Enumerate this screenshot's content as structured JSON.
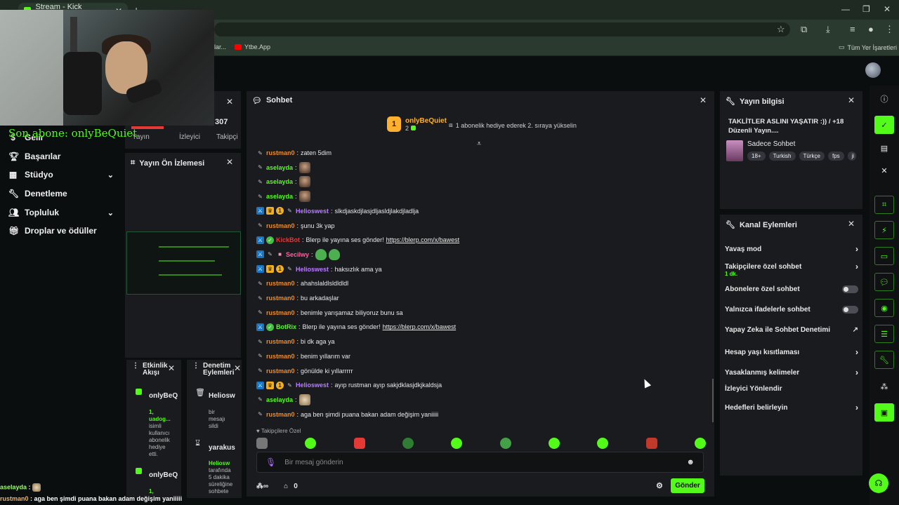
{
  "browser": {
    "tab_title": "Stream - Kick Dashboard",
    "bookmarks": [
      {
        "label": "lar..."
      },
      {
        "label": "Ytbe.App"
      },
      {
        "label": "Tüm Yer İşaretleri"
      }
    ]
  },
  "overlay": {
    "latest_sub": "Son abone: onlyBeQuiet",
    "chat": [
      {
        "user": "aselayda",
        "sep": " : ",
        "text": ""
      },
      {
        "user": "rustman0",
        "sep": " : ",
        "text": "aga ben şimdi puana bakan adam değişim yaniiiii"
      }
    ]
  },
  "sidebar": {
    "items": [
      {
        "label": "Gelir",
        "icon": "dollar-icon"
      },
      {
        "label": "Başarılar",
        "icon": "trophy-icon"
      },
      {
        "label": "Stüdyo",
        "icon": "grid-icon",
        "expandable": true
      },
      {
        "label": "Denetleme",
        "icon": "wrench-icon"
      },
      {
        "label": "Topluluk",
        "icon": "people-icon",
        "expandable": true
      },
      {
        "label": "Droplar ve ödüller",
        "icon": "gift-icon"
      }
    ]
  },
  "stats": {
    "value": "307",
    "labels": [
      "Yayın",
      "İzleyici",
      "Takipçi"
    ]
  },
  "preview": {
    "title": "Yayın Ön İzlemesi"
  },
  "activity_feed": {
    "title": "Etkinlik Akışı",
    "entries": [
      {
        "name": "onlyBeQ",
        "text_line1": "1,",
        "text_line2": "uadog...",
        "text_rest": [
          "isimli",
          "kullanıcı",
          "abonelik",
          "hediye",
          "etti."
        ]
      },
      {
        "name": "onlyBeQ",
        "text_line1": "1,",
        "text_line2": "",
        "text_rest": []
      }
    ]
  },
  "mod_actions": {
    "title": "Denetim Eylemleri",
    "entries": [
      {
        "name": "Heliosw",
        "text": [
          "bir",
          "mesajı",
          "sildi"
        ]
      },
      {
        "name": "yarakus",
        "text": [
          "Heliosw",
          "tarafında",
          "5 dakika",
          "süreliğine",
          "sohbete"
        ]
      }
    ]
  },
  "chat": {
    "title": "Sohbet",
    "pinned": {
      "rank": "1",
      "user": "onlyBeQuiet",
      "count": "2",
      "text": "1 abonelik hediye ederek 2. sıraya yükselin"
    },
    "messages": [
      {
        "user": "rustman0",
        "color": "#f08a24",
        "badges": [
          "pencil"
        ],
        "text": "zaten 5dim"
      },
      {
        "user": "aselayda",
        "color": "#53fc18",
        "badges": [
          "pencil"
        ],
        "text": "",
        "emotes": [
          "face"
        ]
      },
      {
        "user": "aselayda",
        "color": "#53fc18",
        "badges": [
          "pencil"
        ],
        "text": "",
        "emotes": [
          "face"
        ]
      },
      {
        "user": "aselayda",
        "color": "#53fc18",
        "badges": [
          "pencil"
        ],
        "text": "",
        "emotes": [
          "face"
        ]
      },
      {
        "user": "Helioswest",
        "color": "#b87dff",
        "badges": [
          "mod",
          "crown",
          "sub",
          "pencil"
        ],
        "text": "slkdjaskdjlasjdljasldjlakdjladlja"
      },
      {
        "user": "rustman0",
        "color": "#f08a24",
        "badges": [
          "pencil"
        ],
        "text": "şunu 3k yap"
      },
      {
        "user": "KickBot",
        "color": "#e53935",
        "badges": [
          "mod",
          "verified"
        ],
        "text": "Blerp ile yayına ses gönder! ",
        "link": "https://blerp.com/x/bawest"
      },
      {
        "user": "Secilwy",
        "color": "#ff5fa2",
        "badges": [
          "mod",
          "pencil",
          "gift"
        ],
        "text": "",
        "emotes": [
          "frog",
          "frog"
        ]
      },
      {
        "user": "Helioswest",
        "color": "#b87dff",
        "badges": [
          "mod",
          "crown",
          "sub",
          "pencil"
        ],
        "text": "haksızlık ama ya"
      },
      {
        "user": "rustman0",
        "color": "#f08a24",
        "badges": [
          "pencil"
        ],
        "text": "ahahslaldlsldldldl"
      },
      {
        "user": "rustman0",
        "color": "#f08a24",
        "badges": [
          "pencil"
        ],
        "text": "bu arkadaşlar"
      },
      {
        "user": "rustman0",
        "color": "#f08a24",
        "badges": [
          "pencil"
        ],
        "text": "benimle yarışamaz biliyoruz bunu sa"
      },
      {
        "user": "BotRix",
        "color": "#53fc18",
        "badges": [
          "mod",
          "verified"
        ],
        "text": "Blerp ile yayına ses gönder! ",
        "link": "https://blerp.com/x/bawest"
      },
      {
        "user": "rustman0",
        "color": "#f08a24",
        "badges": [
          "pencil"
        ],
        "text": "bi dk aga ya"
      },
      {
        "user": "rustman0",
        "color": "#f08a24",
        "badges": [
          "pencil"
        ],
        "text": "benim yıllarım var"
      },
      {
        "user": "rustman0",
        "color": "#f08a24",
        "badges": [
          "pencil"
        ],
        "text": "gönülde ki yıllarrrrr"
      },
      {
        "user": "Helioswest",
        "color": "#b87dff",
        "badges": [
          "mod",
          "crown",
          "sub",
          "pencil"
        ],
        "text": "ayıp rustman ayıp sakjdklasjdkjkaldsja"
      },
      {
        "user": "aselayda",
        "color": "#53fc18",
        "badges": [
          "pencil"
        ],
        "text": "",
        "emotes": [
          "cat"
        ]
      },
      {
        "user": "rustman0",
        "color": "#f08a24",
        "badges": [
          "pencil"
        ],
        "text": "aga ben şimdi puana bakan adam değişim yaniiiii"
      }
    ],
    "follow_only_label": "Takipçilere Özel",
    "input_placeholder": "Bir mesaj gönderin",
    "points": "0",
    "send_label": "Gönder"
  },
  "stream_info": {
    "title": "Yayın bilgisi",
    "stream_title": "TAKLİTLER ASLINI YAŞATIR :)) / +18 Düzenli Yayın....",
    "category": "Sadece Sohbet",
    "tags": [
      "18+",
      "Turkish",
      "Türkçe",
      "fps",
      "ji"
    ]
  },
  "channel_actions": {
    "title": "Kanal Eylemleri",
    "items": [
      {
        "label": "Yavaş mod",
        "control": "chevron"
      },
      {
        "label": "Takipçilere özel sohbet",
        "sub": "1 dk.",
        "control": "chevron"
      },
      {
        "label": "Abonelere özel sohbet",
        "control": "toggle",
        "on": false
      },
      {
        "label": "Yalnızca ifadelerle sohbet",
        "control": "toggle",
        "on": false
      },
      {
        "label": "Yapay Zeka ile Sohbet Denetimi",
        "control": "external"
      },
      {
        "label": "Hesap yaşı kısıtlaması",
        "control": "chevron"
      },
      {
        "label": "Yasaklanmış kelimeler",
        "control": "chevron"
      },
      {
        "label": "İzleyici Yönlendir",
        "control": "none"
      },
      {
        "label": "Hedefleri belirleyin",
        "control": "chevron"
      }
    ]
  },
  "colors": {
    "accent": "#53fc18",
    "panel": "#191b1f",
    "background": "#0b0e0f"
  }
}
